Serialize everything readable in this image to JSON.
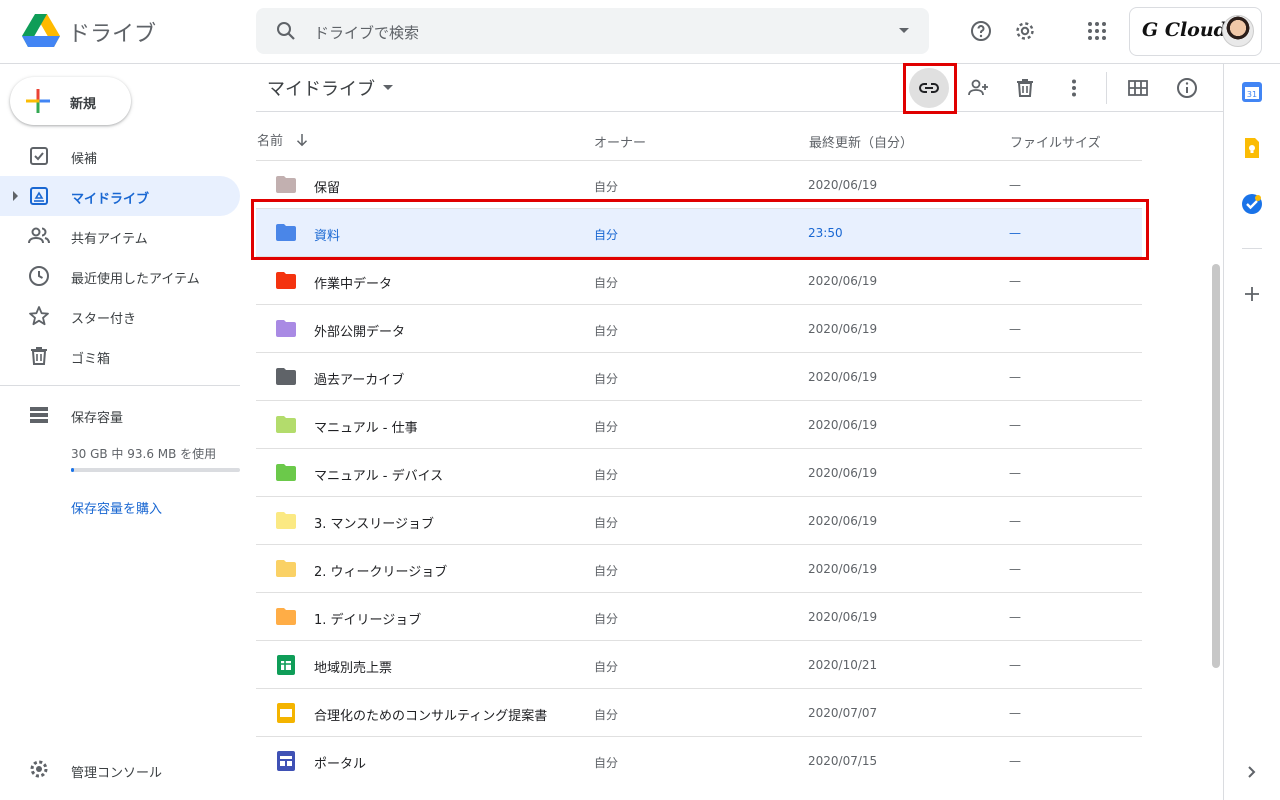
{
  "app": {
    "title": "ドライブ"
  },
  "search": {
    "placeholder": "ドライブで検索"
  },
  "header": {
    "account_brand": "G Cloud"
  },
  "sidebar": {
    "new_label": "新規",
    "items": [
      {
        "label": "候補",
        "icon": "suggested-check-icon",
        "active": false
      },
      {
        "label": "マイドライブ",
        "icon": "my-drive-icon",
        "active": true
      },
      {
        "label": "共有アイテム",
        "icon": "shared-people-icon",
        "active": false
      },
      {
        "label": "最近使用したアイテム",
        "icon": "clock-icon",
        "active": false
      },
      {
        "label": "スター付き",
        "icon": "star-icon",
        "active": false
      },
      {
        "label": "ゴミ箱",
        "icon": "trash-icon",
        "active": false
      }
    ],
    "storage_title": "保存容量",
    "storage_usage": "30 GB 中 93.6 MB を使用",
    "storage_used_fraction": 0.003,
    "buy_storage": "保存容量を購入",
    "admin_console": "管理コンソール"
  },
  "main": {
    "breadcrumb": "マイドライブ",
    "columns": {
      "name": "名前",
      "owner": "オーナー",
      "modified": "最終更新（自分）",
      "size": "ファイルサイズ"
    },
    "rows": [
      {
        "name": "保留",
        "owner": "自分",
        "modified": "2020/06/19",
        "size": "—",
        "type": "folder",
        "color": "#c2b0b0"
      },
      {
        "name": "資料",
        "owner": "自分",
        "modified": "23:50",
        "size": "—",
        "type": "folder",
        "color": "#4a86e8",
        "selected": true
      },
      {
        "name": "作業中データ",
        "owner": "自分",
        "modified": "2020/06/19",
        "size": "—",
        "type": "folder",
        "color": "#f4330f"
      },
      {
        "name": "外部公開データ",
        "owner": "自分",
        "modified": "2020/06/19",
        "size": "—",
        "type": "folder",
        "color": "#a98ae4"
      },
      {
        "name": "過去アーカイブ",
        "owner": "自分",
        "modified": "2020/06/19",
        "size": "—",
        "type": "folder",
        "color": "#5f6368"
      },
      {
        "name": "マニュアル - 仕事",
        "owner": "自分",
        "modified": "2020/06/19",
        "size": "—",
        "type": "folder",
        "color": "#b3dc6c"
      },
      {
        "name": "マニュアル - デバイス",
        "owner": "自分",
        "modified": "2020/06/19",
        "size": "—",
        "type": "folder",
        "color": "#6bc94a"
      },
      {
        "name": "3. マンスリージョブ",
        "owner": "自分",
        "modified": "2020/06/19",
        "size": "—",
        "type": "folder",
        "color": "#fbe983"
      },
      {
        "name": "2. ウィークリージョブ",
        "owner": "自分",
        "modified": "2020/06/19",
        "size": "—",
        "type": "folder",
        "color": "#fad165"
      },
      {
        "name": "1. デイリージョブ",
        "owner": "自分",
        "modified": "2020/06/19",
        "size": "—",
        "type": "folder",
        "color": "#ffad46"
      },
      {
        "name": "地域別売上票",
        "owner": "自分",
        "modified": "2020/10/21",
        "size": "—",
        "type": "sheets",
        "color": "#0f9d58"
      },
      {
        "name": "合理化のためのコンサルティング提案書",
        "owner": "自分",
        "modified": "2020/07/07",
        "size": "—",
        "type": "slides",
        "color": "#f4b400"
      },
      {
        "name": "ポータル",
        "owner": "自分",
        "modified": "2020/07/15",
        "size": "—",
        "type": "sites",
        "color": "#3f51b5"
      }
    ]
  },
  "colors": {
    "accent": "#1a73e8",
    "selected_bg": "#e8f0fe",
    "highlight": "#e00000"
  }
}
